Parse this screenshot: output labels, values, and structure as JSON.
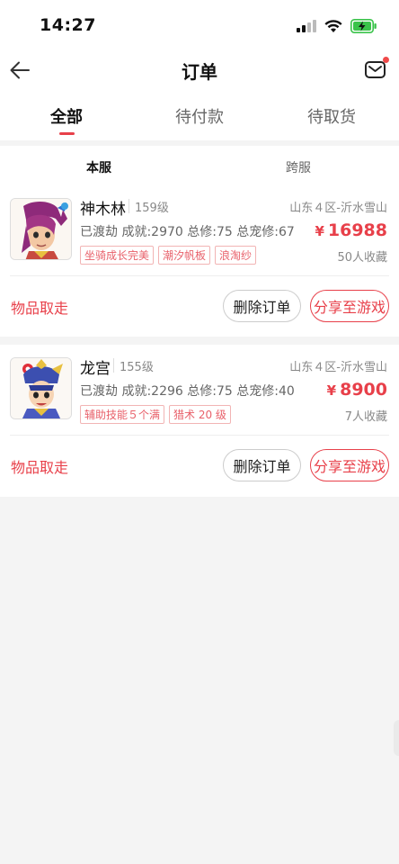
{
  "status_bar": {
    "time": "14:27"
  },
  "header": {
    "title": "订单"
  },
  "tabs": [
    {
      "label": "全部",
      "active": true
    },
    {
      "label": "待付款",
      "active": false
    },
    {
      "label": "待取货",
      "active": false
    }
  ],
  "sub_tabs": [
    {
      "label": "本服",
      "active": true
    },
    {
      "label": "跨服",
      "active": false
    }
  ],
  "orders": [
    {
      "name": "神木林",
      "level": "159级",
      "server": "山东４区-沂水雪山",
      "stats": "已渡劫 成就:2970 总修:75 总宠修:67",
      "currency": "¥",
      "price": "16988",
      "tags": [
        "坐骑成长完美",
        "潮汐帆板",
        "浪淘纱"
      ],
      "favorites": "50人收藏",
      "status_label": "物品取走",
      "delete_label": "删除订单",
      "share_label": "分享至游戏"
    },
    {
      "name": "龙宫",
      "level": "155级",
      "server": "山东４区-沂水雪山",
      "stats": "已渡劫 成就:2296 总修:75 总宠修:40",
      "currency": "¥",
      "price": "8900",
      "tags": [
        "辅助技能５个满",
        "猎术 20 级"
      ],
      "favorites": "7人收藏",
      "status_label": "物品取走",
      "delete_label": "删除订单",
      "share_label": "分享至游戏"
    }
  ],
  "colors": {
    "accent": "#e8404a",
    "background": "#f4f4f4",
    "battery": "#3ac34a"
  }
}
